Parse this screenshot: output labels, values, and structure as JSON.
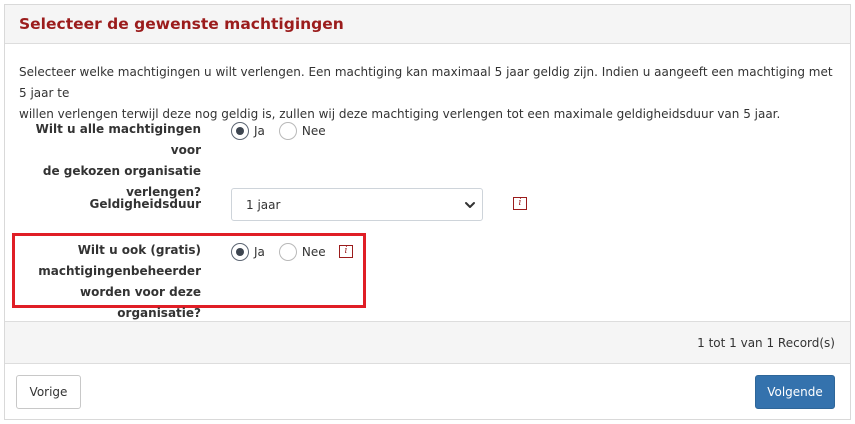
{
  "header": {
    "title": "Selecteer de gewenste machtigingen"
  },
  "intro": {
    "line1": "Selecteer welke machtigingen u wilt verlengen. Een machtiging kan maximaal 5 jaar geldig zijn. Indien u aangeeft een machtiging met 5 jaar te",
    "line2": "willen verlengen terwijl deze nog geldig is, zullen wij deze machtiging verlengen tot een maximale geldigheidsduur van 5 jaar."
  },
  "q1": {
    "label_lines": [
      "Wilt u alle machtigingen voor",
      "de gekozen organisatie",
      "verlengen?"
    ],
    "options": [
      "Ja",
      "Nee"
    ],
    "selected": "Ja"
  },
  "duration": {
    "label": "Geldigheidsduur",
    "value": "1 jaar",
    "info_icon": "i"
  },
  "q2": {
    "label_lines": [
      "Wilt u ook (gratis)",
      "machtigingenbeheerder",
      "worden voor deze organisatie?"
    ],
    "options": [
      "Ja",
      "Nee"
    ],
    "selected": "Ja",
    "info_icon": "i",
    "highlight_color": "#e01e26"
  },
  "records": {
    "text": "1 tot 1 van 1 Record(s)"
  },
  "buttons": {
    "prev": "Vorige",
    "next": "Volgende"
  },
  "colors": {
    "title": "#9b1c1c",
    "primary": "#3472ad"
  }
}
